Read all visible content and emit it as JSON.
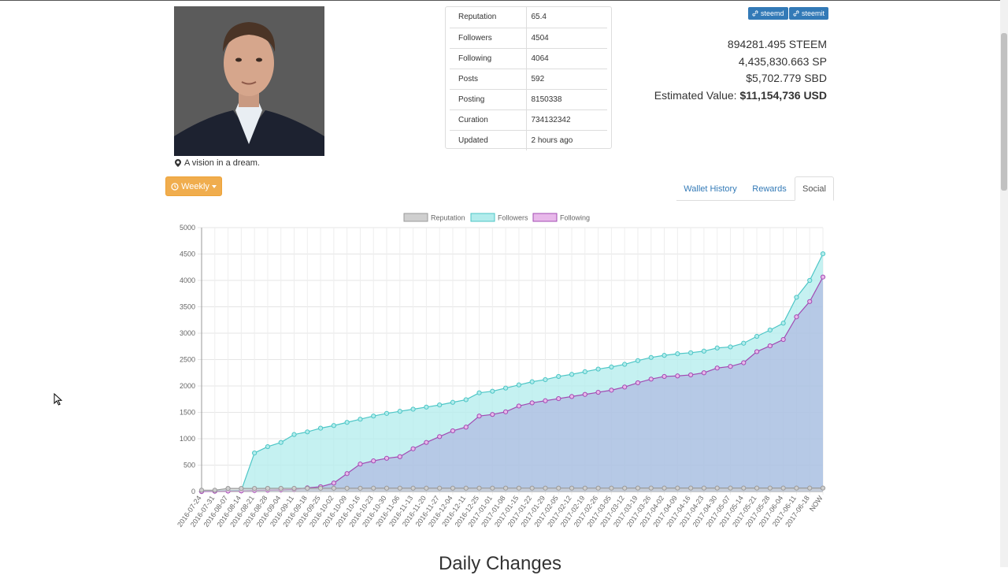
{
  "profile": {
    "location_icon": "map-marker-icon",
    "location": "A vision in a dream."
  },
  "stats": [
    {
      "key": "Reputation",
      "value": "65.4"
    },
    {
      "key": "Followers",
      "value": "4504"
    },
    {
      "key": "Following",
      "value": "4064"
    },
    {
      "key": "Posts",
      "value": "592"
    },
    {
      "key": "Posting",
      "value": "8150338"
    },
    {
      "key": "Curation",
      "value": "734132342"
    },
    {
      "key": "Updated",
      "value": "2 hours ago"
    }
  ],
  "links": {
    "steemd": "steemd",
    "steemit": "steemit",
    "link_icon": "link-icon"
  },
  "balances": {
    "steem": "894281.495 STEEM",
    "sp": "4,435,830.663 SP",
    "sbd": "$5,702.779 SBD",
    "estimated_label": "Estimated Value:",
    "estimated_value": "$11,154,736 USD"
  },
  "controls": {
    "period_label": "Weekly",
    "period_icon": "clock-icon"
  },
  "tabs": [
    {
      "label": "Wallet History",
      "active": false
    },
    {
      "label": "Rewards",
      "active": false
    },
    {
      "label": "Social",
      "active": true
    }
  ],
  "chart_data": {
    "type": "area",
    "title": "",
    "xlabel": "",
    "ylabel": "",
    "ylim": [
      0,
      5000
    ],
    "yticks": [
      0,
      500,
      1000,
      1500,
      2000,
      2500,
      3000,
      3500,
      4000,
      4500,
      5000
    ],
    "grid": true,
    "legend_position": "top-center",
    "categories": [
      "2016-07-24",
      "2016-07-31",
      "2016-08-07",
      "2016-08-14",
      "2016-08-21",
      "2016-08-28",
      "2016-09-04",
      "2016-09-11",
      "2016-09-18",
      "2016-09-25",
      "2016-10-02",
      "2016-10-09",
      "2016-10-16",
      "2016-10-23",
      "2016-10-30",
      "2016-11-06",
      "2016-11-13",
      "2016-11-20",
      "2016-11-27",
      "2016-12-04",
      "2016-12-11",
      "2016-12-25",
      "2017-01-01",
      "2017-01-08",
      "2017-01-15",
      "2017-01-22",
      "2017-01-29",
      "2017-02-05",
      "2017-02-12",
      "2017-02-19",
      "2017-02-26",
      "2017-03-05",
      "2017-03-12",
      "2017-03-19",
      "2017-03-26",
      "2017-04-02",
      "2017-04-09",
      "2017-04-16",
      "2017-04-23",
      "2017-04-30",
      "2017-05-07",
      "2017-05-14",
      "2017-05-21",
      "2017-05-28",
      "2017-06-04",
      "2017-06-11",
      "2017-06-18",
      "NOW"
    ],
    "series": [
      {
        "name": "Reputation",
        "color": "#cfcfcf",
        "stroke": "#9a9a9a",
        "values": [
          25,
          25,
          58,
          58,
          58,
          60,
          60,
          61,
          61,
          62,
          62,
          62,
          62,
          63,
          63,
          63,
          63,
          63,
          63,
          63,
          63,
          64,
          64,
          64,
          64,
          64,
          64,
          64,
          64,
          64,
          64,
          64,
          64,
          65,
          65,
          65,
          65,
          65,
          65,
          65,
          65,
          65,
          65,
          65,
          65,
          65,
          65,
          65
        ]
      },
      {
        "name": "Followers",
        "color": "#b2ecec",
        "stroke": "#4dc6c6",
        "values": [
          5,
          10,
          15,
          20,
          730,
          850,
          930,
          1080,
          1130,
          1200,
          1250,
          1310,
          1370,
          1430,
          1480,
          1520,
          1560,
          1600,
          1640,
          1690,
          1740,
          1870,
          1900,
          1960,
          2020,
          2080,
          2120,
          2180,
          2220,
          2270,
          2320,
          2360,
          2410,
          2480,
          2540,
          2580,
          2610,
          2630,
          2660,
          2720,
          2740,
          2810,
          2940,
          3060,
          3190,
          3680,
          4000,
          4504
        ]
      },
      {
        "name": "Following",
        "color": "#e8b8ea",
        "stroke": "#a24bb3",
        "values": [
          0,
          5,
          8,
          10,
          20,
          25,
          30,
          40,
          70,
          90,
          160,
          340,
          520,
          580,
          630,
          660,
          810,
          930,
          1040,
          1150,
          1220,
          1430,
          1460,
          1510,
          1620,
          1680,
          1720,
          1760,
          1800,
          1840,
          1880,
          1920,
          1980,
          2060,
          2130,
          2180,
          2190,
          2210,
          2250,
          2340,
          2370,
          2440,
          2650,
          2760,
          2880,
          3310,
          3600,
          4064
        ]
      }
    ]
  },
  "section": {
    "daily_changes": "Daily Changes"
  }
}
